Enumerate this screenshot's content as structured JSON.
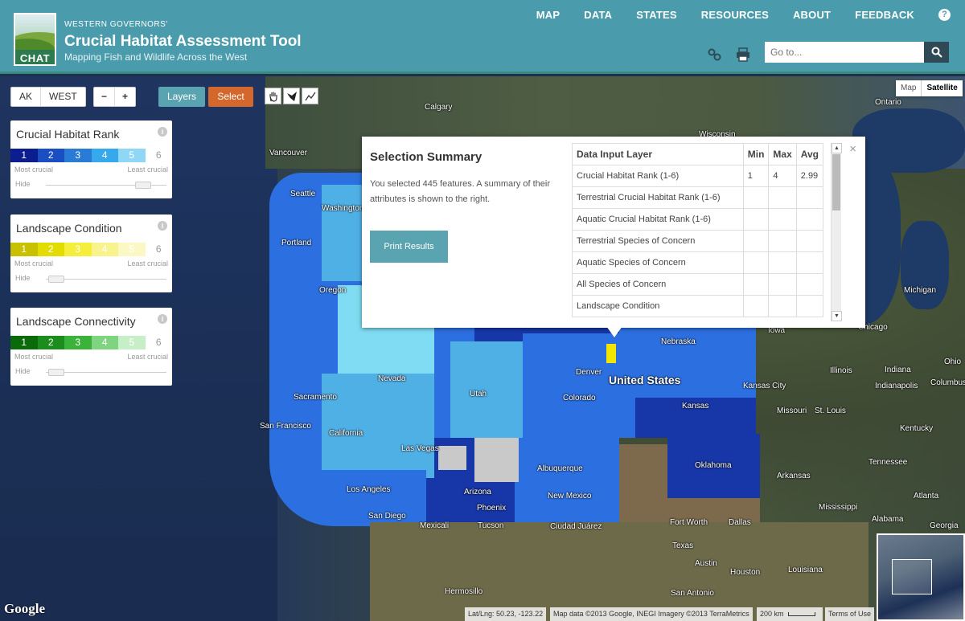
{
  "header": {
    "org": "WESTERN GOVERNORS'",
    "title": "Crucial Habitat Assessment Tool",
    "subtitle": "Mapping Fish and Wildlife Across the West",
    "logo_text": "CHAT",
    "nav": [
      "MAP",
      "DATA",
      "STATES",
      "RESOURCES",
      "ABOUT",
      "FEEDBACK"
    ],
    "help": "?",
    "search_placeholder": "Go to..."
  },
  "toolbar": {
    "regions": [
      "AK",
      "WEST"
    ],
    "zoom_out": "−",
    "zoom_in": "+",
    "layers": "Layers",
    "select": "Select",
    "map_types": [
      "Map",
      "Satellite"
    ]
  },
  "legends": [
    {
      "title": "Crucial Habitat Rank",
      "values": [
        "1",
        "2",
        "3",
        "4",
        "5",
        "6"
      ],
      "colors": [
        "#0b1d8f",
        "#1a4fc4",
        "#2a7bd6",
        "#36a8ec",
        "#8fd7f5",
        "#ffffff"
      ],
      "text_colors": [
        "#fff",
        "#fff",
        "#fff",
        "#fff",
        "#fff",
        "#999"
      ],
      "left": "Most crucial",
      "right": "Least crucial",
      "hide": "Hide",
      "slider": 0.85
    },
    {
      "title": "Landscape Condition",
      "values": [
        "1",
        "2",
        "3",
        "4",
        "5",
        "6"
      ],
      "colors": [
        "#c9c000",
        "#e3dc00",
        "#f5ee3c",
        "#f8f38d",
        "#fbf8c5",
        "#ffffff"
      ],
      "text_colors": [
        "#fff",
        "#fff",
        "#fff",
        "#fff",
        "#fff",
        "#999"
      ],
      "left": "Most crucial",
      "right": "Least crucial",
      "hide": "Hide",
      "slider": 0.02
    },
    {
      "title": "Landscape Connectivity",
      "values": [
        "1",
        "2",
        "3",
        "4",
        "5",
        "6"
      ],
      "colors": [
        "#0b6b0b",
        "#1c8c1c",
        "#3bb33b",
        "#7fd47f",
        "#c7efc7",
        "#ffffff"
      ],
      "text_colors": [
        "#fff",
        "#fff",
        "#fff",
        "#fff",
        "#fff",
        "#999"
      ],
      "left": "Most crucial",
      "right": "Least crucial",
      "hide": "Hide",
      "slider": 0.02
    }
  ],
  "popup": {
    "title": "Selection Summary",
    "summary": "You selected 445 features. A summary of their attributes is shown to the right.",
    "print": "Print Results",
    "close": "×",
    "columns": [
      "Data Input Layer",
      "Min",
      "Max",
      "Avg"
    ],
    "rows": [
      [
        "Crucial Habitat Rank (1-6)",
        "1",
        "4",
        "2.99"
      ],
      [
        "Terrestrial Crucial Habitat Rank (1-6)",
        "",
        "",
        ""
      ],
      [
        "Aquatic Crucial Habitat Rank (1-6)",
        "",
        "",
        ""
      ],
      [
        "Terrestrial Species of Concern",
        "",
        "",
        ""
      ],
      [
        "Aquatic Species of Concern",
        "",
        "",
        ""
      ],
      [
        "All Species of Concern",
        "",
        "",
        ""
      ],
      [
        "Landscape Condition",
        "",
        "",
        ""
      ]
    ]
  },
  "map_labels": [
    "Calgary",
    "Ontario",
    "Vancouver",
    "Seattle",
    "Washington",
    "Portland",
    "Oregon",
    "Nebraska",
    "Iowa",
    "Chicago",
    "Michigan",
    "Nevada",
    "Utah",
    "Denver",
    "Colorado",
    "United States",
    "Illinois",
    "Indiana",
    "Ohio",
    "Indianapolis",
    "Columbus",
    "Sacramento",
    "San Francisco",
    "California",
    "Kansas City",
    "Kansas",
    "Missouri",
    "St. Louis",
    "Kentucky",
    "Las Vegas",
    "Albuquerque",
    "Oklahoma",
    "Tennessee",
    "Arkansas",
    "Los Angeles",
    "Arizona",
    "Phoenix",
    "New Mexico",
    "Atlanta",
    "San Diego",
    "Mexicali",
    "Tucson",
    "Mississippi",
    "Alabama",
    "Georgia",
    "Ciudad Juárez",
    "Fort Worth",
    "Dallas",
    "Texas",
    "Austin",
    "Houston",
    "Louisiana",
    "Hermosillo",
    "San Antonio",
    "Wisconsin"
  ],
  "footer": {
    "google": "Google",
    "latlng": "Lat/Lng: 50.23, -123.22",
    "mapdata": "Map data ©2013 Google, INEGI Imagery ©2013 TerraMetrics",
    "scale": "200 km",
    "terms": "Terms of Use"
  }
}
